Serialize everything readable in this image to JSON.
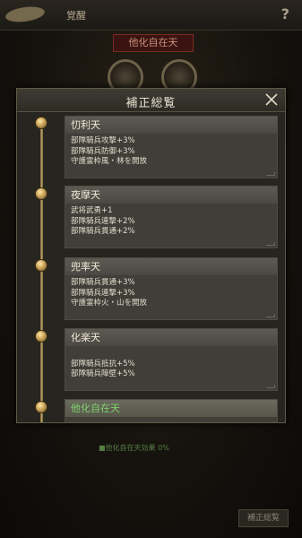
{
  "background": {
    "title": "覚醒",
    "banner": "他化自在天",
    "help_icon": "?",
    "status_text": "■他化自在天効果 0%",
    "corner_button": "補正総覧"
  },
  "panel": {
    "title": "補正総覧",
    "close_icon": "close-x-icon"
  },
  "tiers": [
    {
      "name": "忉利天",
      "lines": [
        "部隊騎兵攻撃+3%",
        "部隊騎兵防御+3%",
        "守護霊枠風・林を開放"
      ],
      "active": false
    },
    {
      "name": "夜摩天",
      "lines": [
        "武将武勇+1",
        "部隊騎兵連撃+2%",
        "部隊騎兵貫通+2%"
      ],
      "active": false
    },
    {
      "name": "兜率天",
      "lines": [
        "部隊騎兵貫通+3%",
        "部隊騎兵連撃+3%",
        "守護霊枠火・山を開放"
      ],
      "active": false
    },
    {
      "name": "化楽天",
      "lines": [
        "",
        "部隊騎兵抵抗+5%",
        "部隊騎兵障壁+5%"
      ],
      "active": false
    },
    {
      "name": "他化自在天",
      "lines": [],
      "active": true
    }
  ],
  "colors": {
    "accent_active": "#7fd46a",
    "node_gold": "#caa35a",
    "panel_bg": "#27251f"
  }
}
